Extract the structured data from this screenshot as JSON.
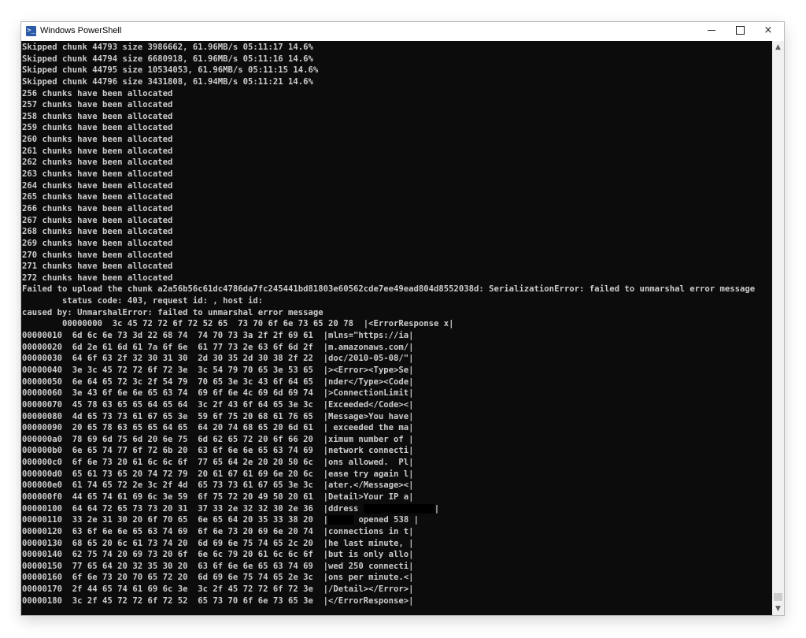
{
  "window": {
    "title": "Windows PowerShell",
    "icon": "powershell-icon",
    "controls": {
      "minimize": "minimize-icon",
      "maximize": "maximize-icon",
      "close": "×"
    }
  },
  "console": {
    "background": "#0c0c0c",
    "foreground": "#cccccc",
    "lines": [
      "Skipped chunk 44793 size 3986662, 61.96MB/s 05:11:17 14.6%",
      "Skipped chunk 44794 size 6680918, 61.96MB/s 05:11:16 14.6%",
      "Skipped chunk 44795 size 10534053, 61.96MB/s 05:11:15 14.6%",
      "Skipped chunk 44796 size 3431808, 61.94MB/s 05:11:21 14.6%",
      "256 chunks have been allocated",
      "257 chunks have been allocated",
      "258 chunks have been allocated",
      "259 chunks have been allocated",
      "260 chunks have been allocated",
      "261 chunks have been allocated",
      "262 chunks have been allocated",
      "263 chunks have been allocated",
      "264 chunks have been allocated",
      "265 chunks have been allocated",
      "266 chunks have been allocated",
      "267 chunks have been allocated",
      "268 chunks have been allocated",
      "269 chunks have been allocated",
      "270 chunks have been allocated",
      "271 chunks have been allocated",
      "272 chunks have been allocated",
      "Failed to upload the chunk a2a56b56c61dc4786da7fc245441bd81803e60562cde7ee49ead804d8552038d: SerializationError: failed to unmarshal error message",
      "        status code: 403, request id: , host id:",
      "caused by: UnmarshalError: failed to unmarshal error message",
      "        00000000  3c 45 72 72 6f 72 52 65  73 70 6f 6e 73 65 20 78  |<ErrorResponse x|",
      "00000010  6d 6c 6e 73 3d 22 68 74  74 70 73 3a 2f 2f 69 61  |mlns=\"https://ia|",
      "00000020  6d 2e 61 6d 61 7a 6f 6e  61 77 73 2e 63 6f 6d 2f  |m.amazonaws.com/|",
      "00000030  64 6f 63 2f 32 30 31 30  2d 30 35 2d 30 38 2f 22  |doc/2010-05-08/\"|",
      "00000040  3e 3c 45 72 72 6f 72 3e  3c 54 79 70 65 3e 53 65  |><Error><Type>Se|",
      "00000050  6e 64 65 72 3c 2f 54 79  70 65 3e 3c 43 6f 64 65  |nder</Type><Code|",
      "00000060  3e 43 6f 6e 6e 65 63 74  69 6f 6e 4c 69 6d 69 74  |>ConnectionLimit|",
      "00000070  45 78 63 65 65 64 65 64  3c 2f 43 6f 64 65 3e 3c  |Exceeded</Code><|",
      "00000080  4d 65 73 73 61 67 65 3e  59 6f 75 20 68 61 76 65  |Message>You have|",
      "00000090  20 65 78 63 65 65 64 65  64 20 74 68 65 20 6d 61  | exceeded the ma|",
      "000000a0  78 69 6d 75 6d 20 6e 75  6d 62 65 72 20 6f 66 20  |ximum number of |",
      "000000b0  6e 65 74 77 6f 72 6b 20  63 6f 6e 6e 65 63 74 69  |network connecti|",
      "000000c0  6f 6e 73 20 61 6c 6c 6f  77 65 64 2e 20 20 50 6c  |ons allowed.  Pl|",
      "000000d0  65 61 73 65 20 74 72 79  20 61 67 61 69 6e 20 6c  |ease try again l|",
      "000000e0  61 74 65 72 2e 3c 2f 4d  65 73 73 61 67 65 3e 3c  |ater.</Message><|",
      "000000f0  44 65 74 61 69 6c 3e 59  6f 75 72 20 49 50 20 61  |Detail>Your IP a|",
      "00000100  64 64 72 65 73 73 20 31  37 33 2e 32 32 30 2e 36  |ddress ",
      "00000110  33 2e 31 30 20 6f 70 65  6e 65 64 20 35 33 38 20  |",
      "00000120  63 6f 6e 6e 65 63 74 69  6f 6e 73 20 69 6e 20 74  |connections in t|",
      "00000130  68 65 20 6c 61 73 74 20  6d 69 6e 75 74 65 2c 20  |he last minute, |",
      "00000140  62 75 74 20 69 73 20 6f  6e 6c 79 20 61 6c 6c 6f  |but is only allo|",
      "00000150  77 65 64 20 32 35 30 20  63 6f 6e 6e 65 63 74 69  |wed 250 connecti|",
      "00000160  6f 6e 73 20 70 65 72 20  6d 69 6e 75 74 65 2e 3c  |ons per minute.<|",
      "00000170  2f 44 65 74 61 69 6c 3e  3c 2f 45 72 72 6f 72 3e  |/Detail></Error>|",
      "00000180  3c 2f 45 72 72 6f 72 52  65 73 70 6f 6e 73 65 3e  |</ErrorResponse>|"
    ],
    "redacted_tails": {
      "00000100": "|",
      "00000110": " opened 538 |"
    }
  }
}
